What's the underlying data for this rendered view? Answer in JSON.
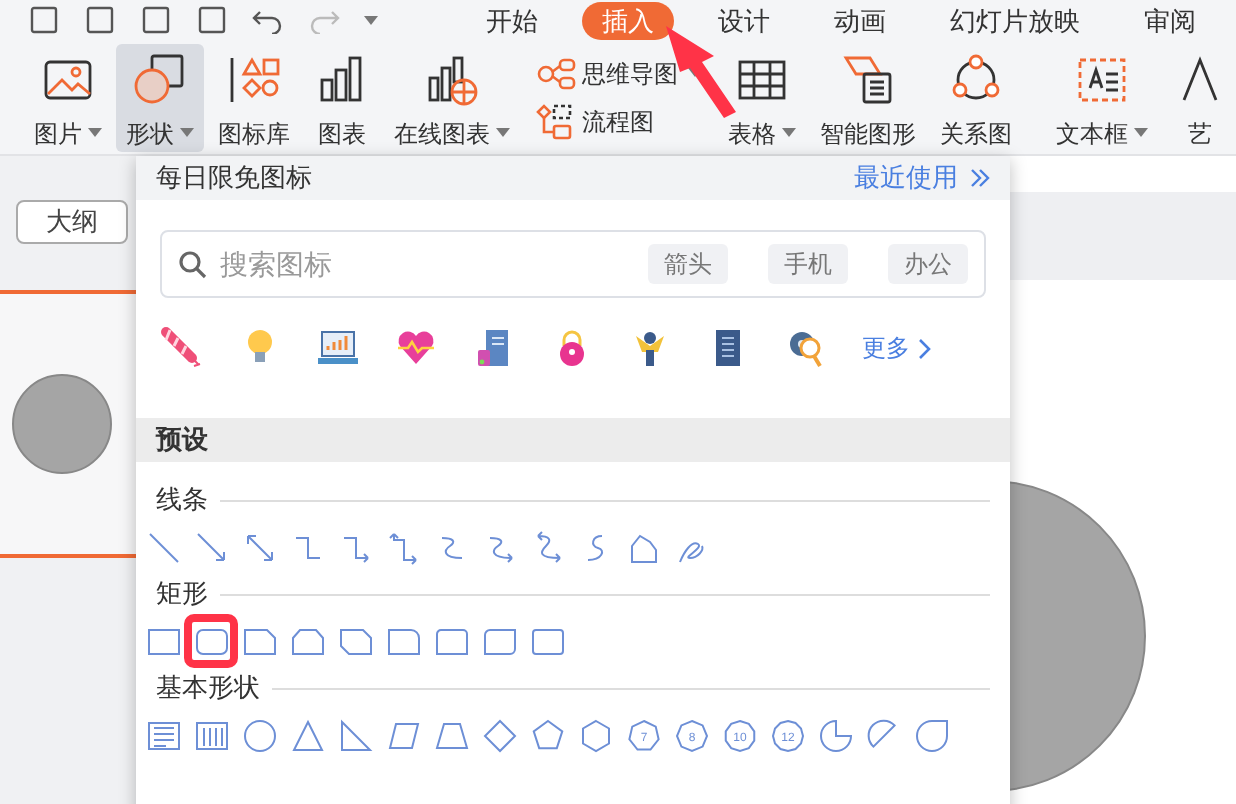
{
  "menu_tabs": [
    {
      "label": "开始",
      "selected": false
    },
    {
      "label": "插入",
      "selected": true
    },
    {
      "label": "设计",
      "selected": false
    },
    {
      "label": "动画",
      "selected": false
    },
    {
      "label": "幻灯片放映",
      "selected": false
    },
    {
      "label": "审阅",
      "selected": false
    }
  ],
  "ribbon": [
    {
      "kind": "image",
      "label": "图片",
      "dropdown": true,
      "selected": false
    },
    {
      "kind": "shape",
      "label": "形状",
      "dropdown": true,
      "selected": true
    },
    {
      "kind": "iconlib",
      "label": "图标库",
      "dropdown": false,
      "selected": false
    },
    {
      "kind": "chart",
      "label": "图表",
      "dropdown": false,
      "selected": false
    },
    {
      "kind": "onlinechart",
      "label": "在线图表",
      "dropdown": true,
      "selected": false
    },
    {
      "kind": "stack",
      "items": [
        {
          "kind": "mindmap",
          "label": "思维导图",
          "dropdown": true
        },
        {
          "kind": "flowchart",
          "label": "流程图",
          "dropdown": false
        }
      ]
    },
    {
      "kind": "table",
      "label": "表格",
      "dropdown": true,
      "selected": false
    },
    {
      "kind": "smartart",
      "label": "智能图形",
      "dropdown": false,
      "selected": false
    },
    {
      "kind": "relation",
      "label": "关系图",
      "dropdown": false,
      "selected": false
    },
    {
      "kind": "textbox",
      "label": "文本框",
      "dropdown": true,
      "selected": false
    },
    {
      "kind": "art",
      "label": "艺",
      "dropdown": false,
      "selected": false
    }
  ],
  "sidebar": {
    "tab": "大纲"
  },
  "shape_panel": {
    "title": "每日限免图标",
    "recent_link": "最近使用",
    "search": {
      "placeholder": "搜索图标",
      "tags": [
        "箭头",
        "手机",
        "办公"
      ]
    },
    "more_link": "更多",
    "section": "预设",
    "groups": [
      {
        "kind": "lines",
        "label": "线条"
      },
      {
        "kind": "rectangles",
        "label": "矩形"
      },
      {
        "kind": "basic",
        "label": "基本形状",
        "polygon_labels": [
          "7",
          "8",
          "10",
          "12"
        ]
      }
    ]
  }
}
